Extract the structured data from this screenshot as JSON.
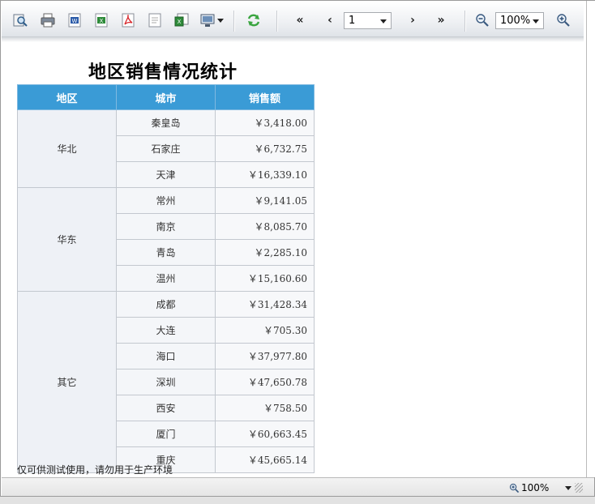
{
  "toolbar": {
    "current_page": "1",
    "zoom": "100%",
    "nav_first": "«",
    "nav_prev": "‹",
    "nav_next": "›",
    "nav_last": "»"
  },
  "report": {
    "title": "地区销售情况统计",
    "headers": [
      "地区",
      "城市",
      "销售额"
    ],
    "groups": [
      {
        "region": "华北",
        "rows": [
          {
            "city": "秦皇岛",
            "amount": "￥3,418.00"
          },
          {
            "city": "石家庄",
            "amount": "￥6,732.75"
          },
          {
            "city": "天津",
            "amount": "￥16,339.10"
          }
        ]
      },
      {
        "region": "华东",
        "rows": [
          {
            "city": "常州",
            "amount": "￥9,141.05"
          },
          {
            "city": "南京",
            "amount": "￥8,085.70"
          },
          {
            "city": "青岛",
            "amount": "￥2,285.10"
          },
          {
            "city": "温州",
            "amount": "￥15,160.60"
          }
        ]
      },
      {
        "region": "其它",
        "rows": [
          {
            "city": "成都",
            "amount": "￥31,428.34"
          },
          {
            "city": "大连",
            "amount": "￥705.30"
          },
          {
            "city": "海口",
            "amount": "￥37,977.80"
          },
          {
            "city": "深圳",
            "amount": "￥47,650.78"
          },
          {
            "city": "西安",
            "amount": "￥758.50"
          },
          {
            "city": "厦门",
            "amount": "￥60,663.45"
          },
          {
            "city": "重庆",
            "amount": "￥45,665.14"
          }
        ]
      }
    ],
    "footnote": "仅可供测试使用，请勿用于生产环境"
  },
  "statusbar": {
    "zoom": "100%"
  },
  "colors": {
    "header_bg": "#3a9bd6",
    "header_text": "#ffffff",
    "region_bg": "#eef1f6"
  },
  "icons": [
    "search-icon",
    "print-icon",
    "word-export-icon",
    "excel-export-icon",
    "pdf-export-icon",
    "text-export-icon",
    "excel-data-export-icon",
    "display-mode-icon",
    "refresh-icon",
    "zoom-out-icon",
    "zoom-in-icon"
  ]
}
